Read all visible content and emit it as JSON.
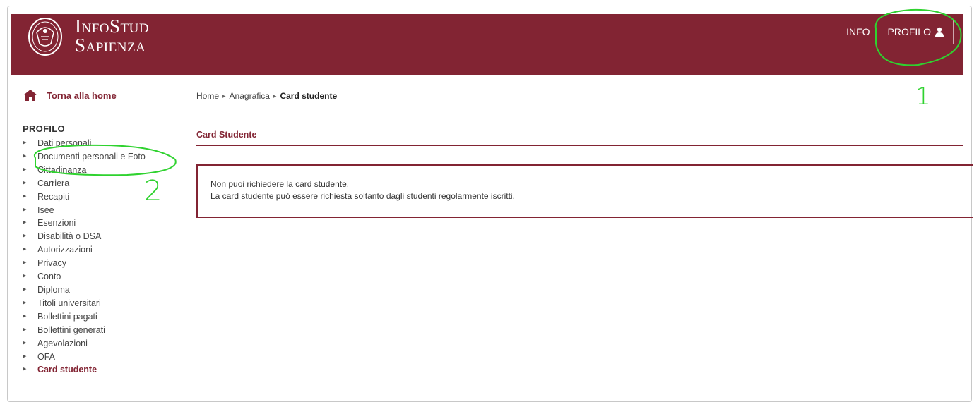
{
  "brand": {
    "line1": "InfoStud",
    "line2": "Sapienza",
    "colors": {
      "primary": "#822433",
      "text": "#333333",
      "annotation": "#2fd22f"
    }
  },
  "header_nav": {
    "info_label": "INFO",
    "profile_label": "PROFILO",
    "profile_icon": "user-icon"
  },
  "home_link": {
    "label": "Torna alla home",
    "icon": "home-icon"
  },
  "breadcrumb": {
    "items": [
      "Home",
      "Anagrafica"
    ],
    "current": "Card studente"
  },
  "sidebar": {
    "title": "PROFILO",
    "items": [
      {
        "label": "Dati personali"
      },
      {
        "label": "Documenti personali e Foto"
      },
      {
        "label": "Cittadinanza"
      },
      {
        "label": "Carriera"
      },
      {
        "label": "Recapiti"
      },
      {
        "label": "Isee"
      },
      {
        "label": "Esenzioni"
      },
      {
        "label": "Disabilità o DSA"
      },
      {
        "label": "Autorizzazioni"
      },
      {
        "label": "Privacy"
      },
      {
        "label": "Conto"
      },
      {
        "label": "Diploma"
      },
      {
        "label": "Titoli universitari"
      },
      {
        "label": "Bollettini pagati"
      },
      {
        "label": "Bollettini generati"
      },
      {
        "label": "Agevolazioni"
      },
      {
        "label": "OFA"
      },
      {
        "label": "Card studente",
        "active": true
      }
    ]
  },
  "main": {
    "section_title": "Card Studente",
    "message_line1": "Non puoi richiedere la card studente.",
    "message_line2": "La card studente può essere richiesta soltanto dagli studenti regolarmente iscritti."
  },
  "annotations": {
    "step1": "1",
    "step2": "2"
  }
}
